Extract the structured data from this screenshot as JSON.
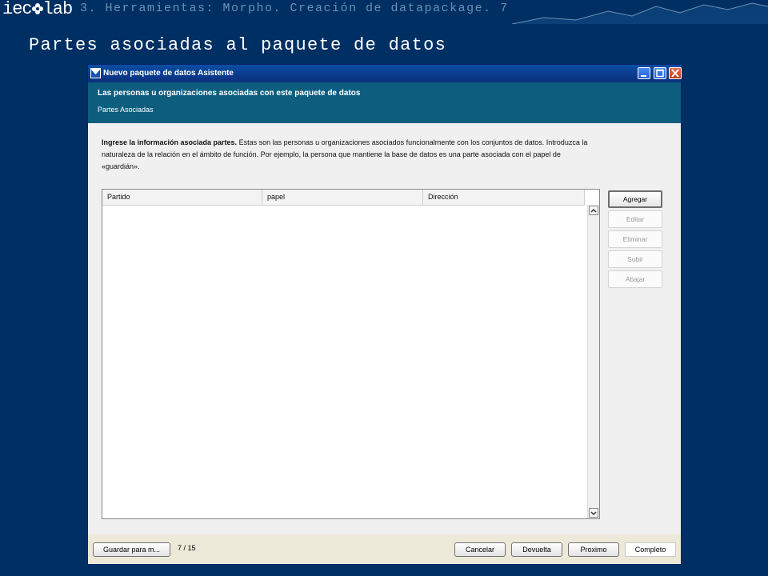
{
  "slide": {
    "logo": "iecolab",
    "breadcrumb": "3. Herramientas: Morpho. Creación de datapackage. 7",
    "title": "Partes asociadas al paquete de datos"
  },
  "window": {
    "title": "Nuevo paquete de datos Asistente",
    "header_title": "Las personas u organizaciones asociadas con este paquete de datos",
    "header_subtitle": "Partes Asociadas",
    "description_bold": "Ingrese la información asociada partes.",
    "description_line1": " Estas son las personas u organizaciones asociados funcionalmente con los conjuntos de datos. Introduzca la",
    "description_line2": "naturaleza de la relación en el ámbito de función. Por ejemplo, la persona que mantiene la base de datos es una parte asociada con el papel de",
    "description_line3": "«guardián».",
    "table": {
      "columns": [
        "Partido",
        "papel",
        "Dirección"
      ],
      "rows": []
    },
    "side_buttons": [
      {
        "label": "Agregar",
        "enabled": true
      },
      {
        "label": "Editar",
        "enabled": false
      },
      {
        "label": "Eliminar",
        "enabled": false
      },
      {
        "label": "Subir",
        "enabled": false
      },
      {
        "label": "Abajar",
        "enabled": false
      }
    ],
    "footer": {
      "save_label": "Guardar para m...",
      "page_indicator": "7 / 15",
      "cancel_label": "Cancelar",
      "back_label": "Devuelta",
      "next_label": "Proximo",
      "finish_label": "Completo"
    }
  },
  "colors": {
    "slide_background": "#003063",
    "header_band": "#0d5d7f",
    "titlebar": "#0b3a8c"
  },
  "icons": [
    "logo-flower-icon",
    "app-icon",
    "minimize-icon",
    "maximize-icon",
    "close-icon",
    "scroll-up-icon",
    "scroll-down-icon"
  ]
}
